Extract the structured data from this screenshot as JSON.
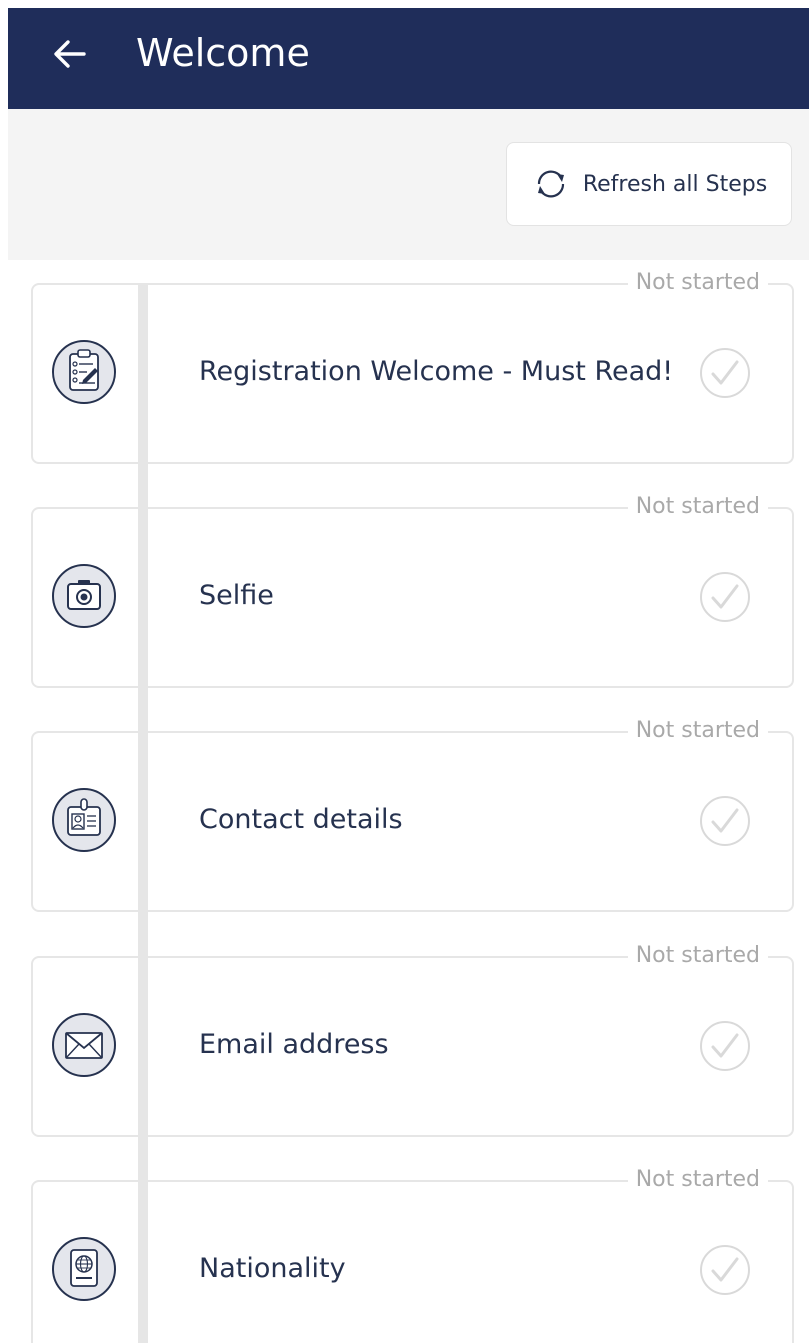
{
  "header": {
    "title": "Welcome",
    "back_icon": "arrow-left-icon"
  },
  "toolbar": {
    "refresh_label": "Refresh all Steps",
    "refresh_icon": "refresh-icon"
  },
  "steps": [
    {
      "label": "Registration Welcome - Must Read!",
      "status": "Not started",
      "icon": "clipboard-checklist-icon"
    },
    {
      "label": "Selfie",
      "status": "Not started",
      "icon": "camera-icon"
    },
    {
      "label": "Contact details",
      "status": "Not started",
      "icon": "id-badge-icon"
    },
    {
      "label": "Email address",
      "status": "Not started",
      "icon": "envelope-icon"
    },
    {
      "label": "Nationality",
      "status": "Not started",
      "icon": "passport-icon"
    }
  ],
  "colors": {
    "header_bg": "#1f2d5a",
    "text": "#26324f",
    "status_text": "#a9a9a9",
    "border": "#e6e6e6",
    "toolbar_bg": "#f4f4f4"
  }
}
